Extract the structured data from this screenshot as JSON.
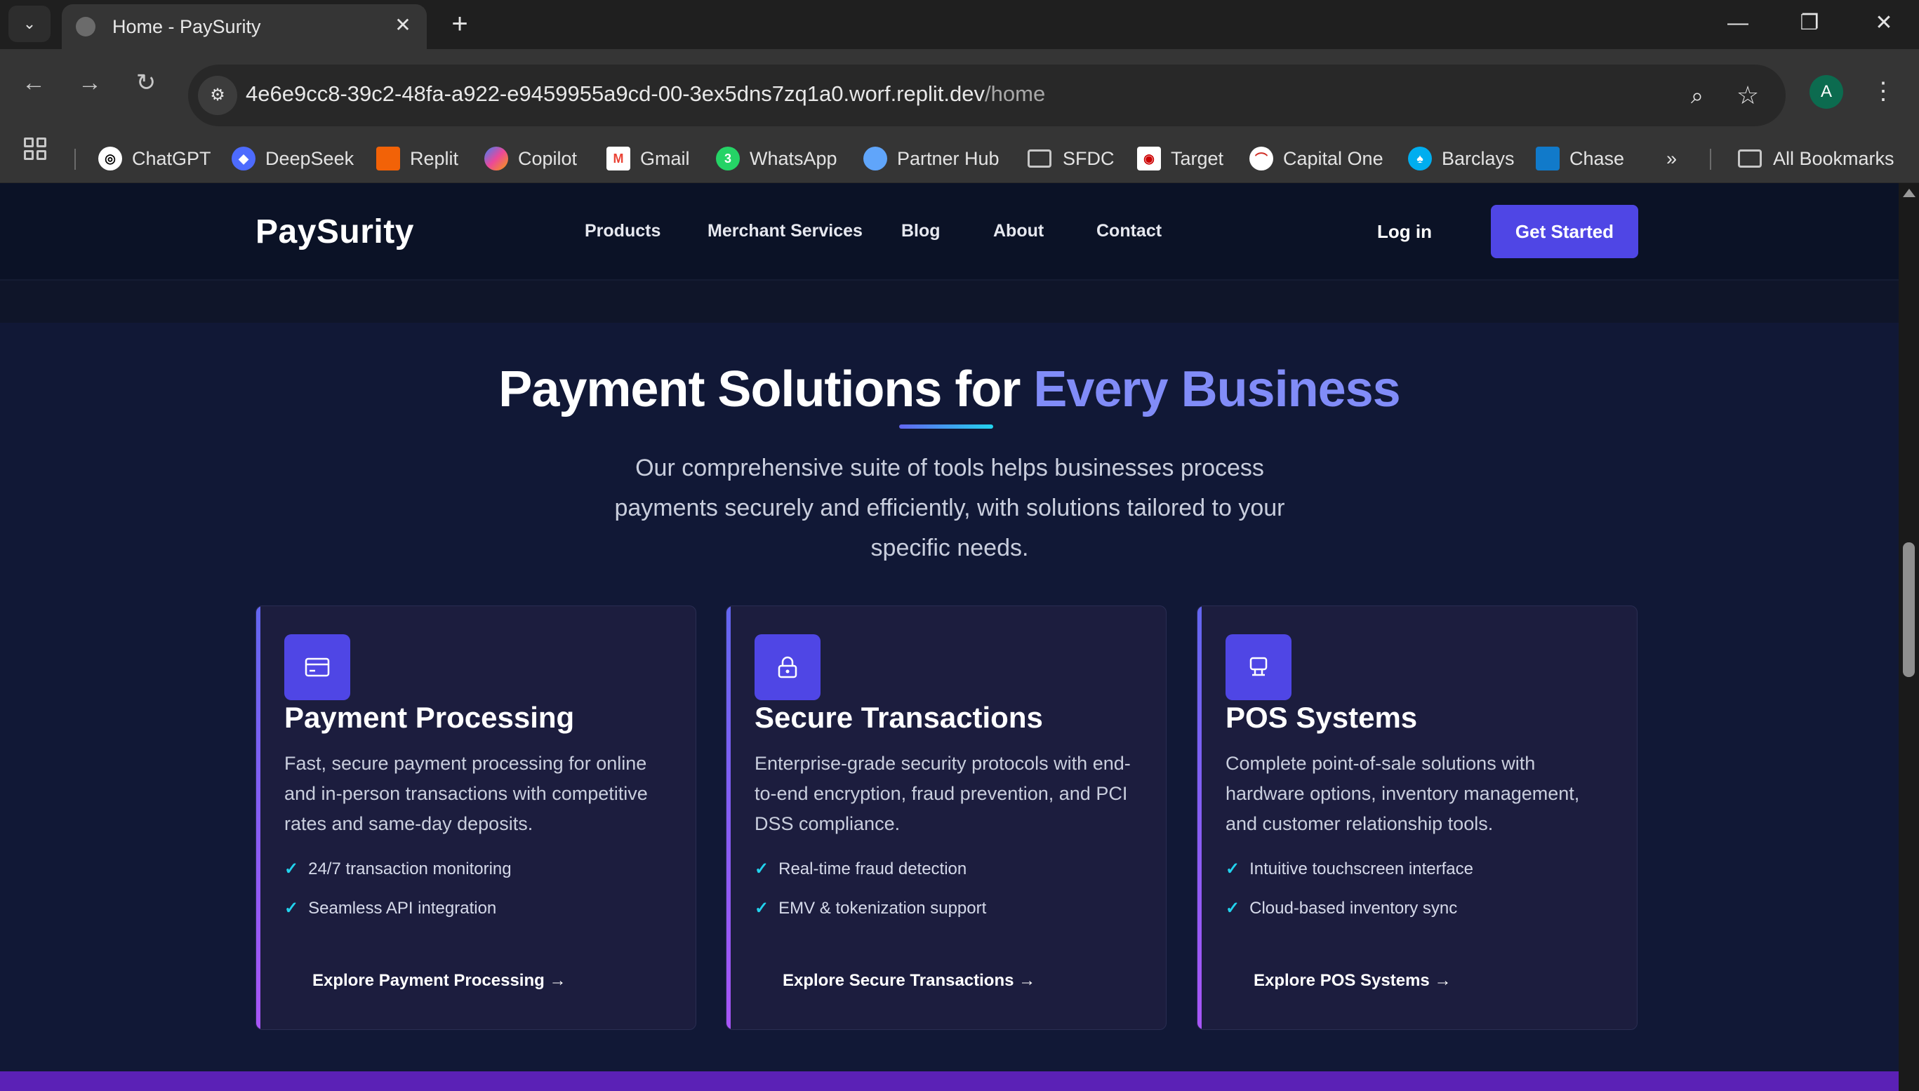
{
  "browser": {
    "tab_title": "Home - PaySurity",
    "url_host": "4e6e9cc8-39c2-48fa-a922-e9459955a9cd-00-3ex5dns7zq1a0.worf.replit.dev",
    "url_path": "/home",
    "profile_initial": "A",
    "bookmarks": [
      "ChatGPT",
      "DeepSeek",
      "Replit",
      "Copilot",
      "Gmail",
      "WhatsApp",
      "Partner Hub",
      "SFDC",
      "Target",
      "Capital One",
      "Barclays",
      "Chase"
    ],
    "all_bookmarks": "All Bookmarks",
    "overflow": "»"
  },
  "nav": {
    "logo": "PaySurity",
    "links": [
      "Products",
      "Merchant Services",
      "Blog",
      "About",
      "Contact"
    ],
    "login": "Log in",
    "cta": "Get Started"
  },
  "hero": {
    "title_main": "Payment Solutions for ",
    "title_accent": "Every Business",
    "subtitle": "Our comprehensive suite of tools helps businesses process payments securely and efficiently, with solutions tailored to your specific needs."
  },
  "cards": [
    {
      "icon": "credit-card-icon",
      "title": "Payment Processing",
      "description": "Fast, secure payment processing for online and in-person transactions with competitive rates and same-day deposits.",
      "features": [
        "24/7 transaction monitoring",
        "Seamless API integration"
      ],
      "link": "Explore Payment Processing →"
    },
    {
      "icon": "lock-icon",
      "title": "Secure Transactions",
      "description": "Enterprise-grade security protocols with end-to-end encryption, fraud prevention, and PCI DSS compliance.",
      "features": [
        "Real-time fraud detection",
        "EMV & tokenization support"
      ],
      "link": "Explore Secure Transactions →"
    },
    {
      "icon": "pos-terminal-icon",
      "title": "POS Systems",
      "description": "Complete point-of-sale solutions with hardware options, inventory management, and customer relationship tools.",
      "features": [
        "Intuitive touchscreen interface",
        "Cloud-based inventory sync"
      ],
      "link": "Explore POS Systems →"
    }
  ],
  "check_mark": "✓",
  "colors": {
    "accent": "#4f46e5",
    "accent_light": "#818cf8",
    "check": "#22d3ee",
    "card_bg": "#1c1d3e"
  }
}
